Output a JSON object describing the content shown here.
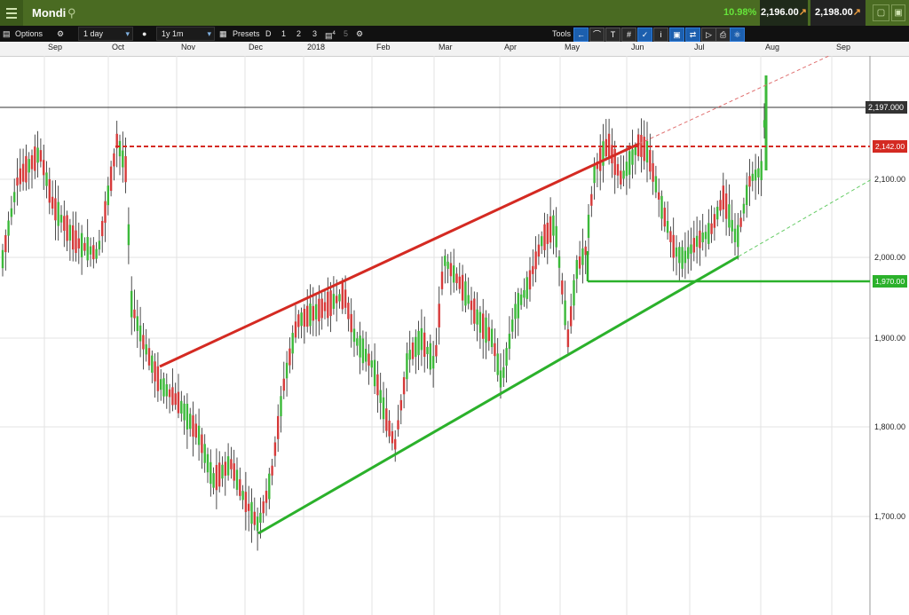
{
  "header": {
    "title": "Mondi",
    "change": "10.98%",
    "bid": "2,196.00",
    "offer": "2,198.00"
  },
  "toolbar": {
    "options": "Options",
    "interval": "1 day",
    "range": "1y 1m",
    "presets": "Presets",
    "preset_buttons": [
      "D",
      "1",
      "2",
      "3",
      "4",
      "5"
    ],
    "tools": "Tools"
  },
  "months": [
    "Sep",
    "Oct",
    "Nov",
    "Dec",
    "2018",
    "Feb",
    "Mar",
    "Apr",
    "May",
    "Jun",
    "Jul",
    "Aug",
    "Sep"
  ],
  "chart_data": {
    "type": "candlestick",
    "instrument": "Mondi",
    "y_ticks": [
      "1,700.00",
      "1,800.00",
      "1,900.00",
      "2,000.00",
      "2,100.00"
    ],
    "ylim": [
      1610,
      2250
    ],
    "current_price_label": "2,197.000",
    "resistance_label": "2,142.00",
    "support_label": "1,970.00",
    "resistance_level": 2142,
    "support_level": 1970,
    "current_price": 2197,
    "colors": {
      "up": "#3cb93a",
      "down": "#d63a3a",
      "resistance": "#d42a22",
      "support": "#2bb12b"
    }
  }
}
